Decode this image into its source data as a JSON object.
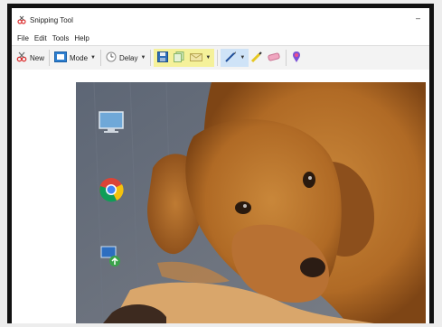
{
  "window": {
    "title": "Snipping Tool",
    "minimize_glyph": "–"
  },
  "menu": {
    "items": [
      "File",
      "Edit",
      "Tools",
      "Help"
    ]
  },
  "toolbar": {
    "new_label": "New",
    "mode_label": "Mode",
    "delay_label": "Delay",
    "icons": [
      "scissors-icon",
      "mode-icon",
      "clock-icon",
      "save-icon",
      "copy-icon",
      "email-icon",
      "pen-icon",
      "highlighter-icon",
      "eraser-icon",
      "paint3d-icon"
    ]
  },
  "capture": {
    "desktop_icons": [
      {
        "name": "monitor-icon",
        "label": ""
      },
      {
        "name": "chrome-icon",
        "label": ""
      },
      {
        "name": "network-icon",
        "label": ""
      }
    ]
  },
  "colors": {
    "accent_yellow": "#f5f19a",
    "accent_blue": "#cfe3f7",
    "dog_fur": "#b8752e"
  }
}
